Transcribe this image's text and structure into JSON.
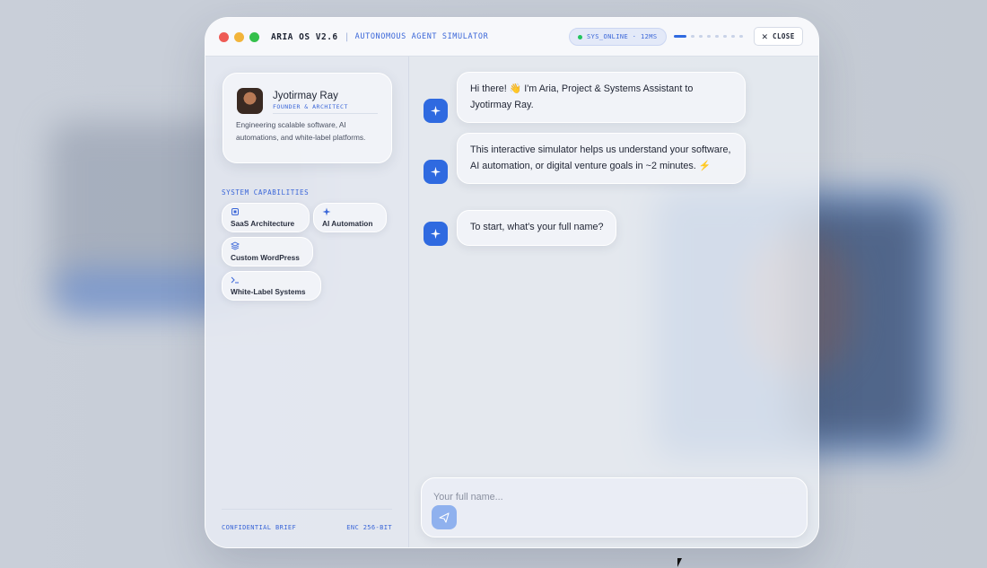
{
  "window": {
    "app_name": "ARIA OS V2.6",
    "separator": "|",
    "subtitle": "AUTONOMOUS AGENT SIMULATOR",
    "status": "SYS_ONLINE · 12MS",
    "progress_fraction": 0.125,
    "close_label": "CLOSE",
    "colors": {
      "red": "#ee5b55",
      "yellow": "#f2b43a",
      "green": "#35c04b",
      "accent": "#2f6ae0"
    }
  },
  "profile": {
    "name": "Jyotirmay Ray",
    "role": "FOUNDER & ARCHITECT",
    "description": "Engineering scalable software, AI automations, and white-label platforms."
  },
  "capabilities": {
    "title": "SYSTEM CAPABILITIES",
    "items": [
      {
        "label": "SaaS Architecture",
        "icon": "chip-icon"
      },
      {
        "label": "AI Automation",
        "icon": "sparkle-icon"
      },
      {
        "label": "Custom WordPress",
        "icon": "layers-icon"
      },
      {
        "label": "White-Label Systems",
        "icon": "terminal-icon"
      }
    ]
  },
  "sidebar_footer": {
    "left": "CONFIDENTIAL BRIEF",
    "right": "ENC 256-BIT"
  },
  "messages": [
    {
      "sender": "aria",
      "text": "Hi there! 👋 I'm Aria, Project & Systems Assistant to Jyotirmay Ray."
    },
    {
      "sender": "aria",
      "text": "This interactive simulator helps us understand your software, AI automation, or digital venture goals in ~2 minutes. ⚡"
    },
    {
      "sender": "aria",
      "text": "To start, what's your full name?"
    }
  ],
  "composer": {
    "placeholder": "Your full name...",
    "value": ""
  }
}
